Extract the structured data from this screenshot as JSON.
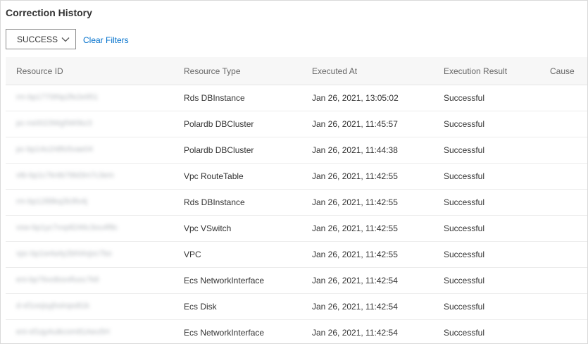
{
  "page": {
    "title": "Correction History"
  },
  "filters": {
    "status_value": "SUCCESS",
    "clear_label": "Clear Filters"
  },
  "table": {
    "columns": [
      "Resource ID",
      "Resource Type",
      "Executed At",
      "Execution Result",
      "Cause"
    ],
    "rows": [
      {
        "resource_id": "rm-bp1770tNp2fe2e951",
        "resource_type": "Rds DBInstance",
        "executed_at": "Jan 26, 2021, 13:05:02",
        "result": "Successful",
        "cause": ""
      },
      {
        "resource_id": "pc-ns0023Wg5W0kz3",
        "resource_type": "Polardb DBCluster",
        "executed_at": "Jan 26, 2021, 11:45:57",
        "result": "Successful",
        "cause": ""
      },
      {
        "resource_id": "pc-bp14s1h8fo5vae04",
        "resource_type": "Polardb DBCluster",
        "executed_at": "Jan 26, 2021, 11:44:38",
        "result": "Successful",
        "cause": ""
      },
      {
        "resource_id": "vtb-bp1c7kntb7t8d3m7c3em",
        "resource_type": "Vpc RouteTable",
        "executed_at": "Jan 26, 2021, 11:42:55",
        "result": "Successful",
        "cause": ""
      },
      {
        "resource_id": "rm-bp1288kq2b3fo4j",
        "resource_type": "Rds DBInstance",
        "executed_at": "Jan 26, 2021, 11:42:55",
        "result": "Successful",
        "cause": ""
      },
      {
        "resource_id": "vsw-bp1yc7vvp8246c3ou4f8c",
        "resource_type": "Vpc VSwitch",
        "executed_at": "Jan 26, 2021, 11:42:55",
        "result": "Successful",
        "cause": ""
      },
      {
        "resource_id": "vpc-bp1w4a4y2bhl4xjoc7bo",
        "resource_type": "VPC",
        "executed_at": "Jan 26, 2021, 11:42:55",
        "result": "Successful",
        "cause": ""
      },
      {
        "resource_id": "eni-bp76vo8oo4fuoc7k8",
        "resource_type": "Ecs NetworkInterface",
        "executed_at": "Jan 26, 2021, 11:42:54",
        "result": "Successful",
        "cause": ""
      },
      {
        "resource_id": "d-sf1oojsyjhoirqodt1k",
        "resource_type": "Ecs Disk",
        "executed_at": "Jan 26, 2021, 11:42:54",
        "result": "Successful",
        "cause": ""
      },
      {
        "resource_id": "eni-sf1qyAuikcom81Aeu5H",
        "resource_type": "Ecs NetworkInterface",
        "executed_at": "Jan 26, 2021, 11:42:54",
        "result": "Successful",
        "cause": ""
      }
    ]
  }
}
